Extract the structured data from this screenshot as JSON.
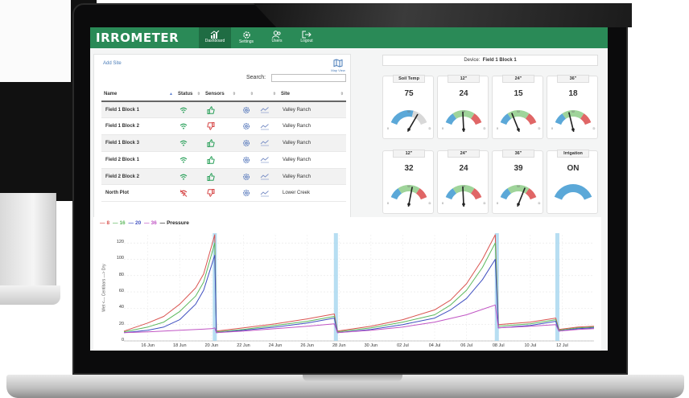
{
  "app": {
    "brand": "IRROMETER",
    "nav": [
      {
        "label": "Dashboard",
        "icon": "chart-bars-icon",
        "active": true
      },
      {
        "label": "Settings",
        "icon": "gear-icon",
        "active": false
      },
      {
        "label": "Users",
        "icon": "users-icon",
        "active": false
      },
      {
        "label": "Logout",
        "icon": "logout-icon",
        "active": false
      }
    ]
  },
  "sites": {
    "add_site": "Add Site",
    "map_view": "Map View",
    "search_label": "Search:",
    "search_value": "",
    "columns": [
      "Name",
      "Status",
      "Sensors",
      "",
      "",
      "Site"
    ],
    "rows": [
      {
        "name": "Field 1 Block 1",
        "status": "online",
        "sensors": "up",
        "site": "Valley Ranch"
      },
      {
        "name": "Field 1 Block 2",
        "status": "online",
        "sensors": "down",
        "site": "Valley Ranch"
      },
      {
        "name": "Field 1 Block 3",
        "status": "online",
        "sensors": "up",
        "site": "Valley Ranch"
      },
      {
        "name": "Field 2 Block 1",
        "status": "online",
        "sensors": "up",
        "site": "Valley Ranch"
      },
      {
        "name": "Field 2 Block 2",
        "status": "online",
        "sensors": "up",
        "site": "Valley Ranch"
      },
      {
        "name": "North Plot",
        "status": "offline",
        "sensors": "down",
        "site": "Lower Creek"
      }
    ]
  },
  "device": {
    "label": "Device:",
    "name": "Field 1 Block 1"
  },
  "gauges": [
    {
      "title": "Soil Temp",
      "value": "75",
      "needle": 0.72,
      "kind": "temp"
    },
    {
      "title": "12\"",
      "value": "24",
      "needle": 0.48,
      "kind": "moisture"
    },
    {
      "title": "24\"",
      "value": "15",
      "needle": 0.34,
      "kind": "moisture"
    },
    {
      "title": "36\"",
      "value": "18",
      "needle": 0.4,
      "kind": "moisture"
    },
    {
      "title": "12\"",
      "value": "32",
      "needle": 0.58,
      "kind": "moisture"
    },
    {
      "title": "24\"",
      "value": "24",
      "needle": 0.48,
      "kind": "moisture"
    },
    {
      "title": "36\"",
      "value": "39",
      "needle": 0.66,
      "kind": "moisture"
    },
    {
      "title": "Irrigation",
      "value": "ON",
      "needle": null,
      "kind": "irrigation"
    }
  ],
  "gauge_scale_labels": {
    "low": "0",
    "mid": "W",
    "high": "D"
  },
  "colors": {
    "brand_green": "#2a8a57",
    "series_8": "#d9534f",
    "series_16": "#5cb85c",
    "series_20": "#3f4fc0",
    "series_36": "#c054c4",
    "pressure": "#222222",
    "gauge_blue": "#5ba8d8",
    "gauge_green": "#9fd49a",
    "gauge_red": "#e06666",
    "irrigation_band": "#9fd3ee"
  },
  "chart_data": {
    "type": "line",
    "legend": [
      "8",
      "16",
      "20",
      "36",
      "Pressure"
    ],
    "ylabel": "Wet <--- Centibars ---> Dry",
    "ylim": [
      0,
      130
    ],
    "yticks": [
      0,
      20,
      40,
      60,
      80,
      100,
      120
    ],
    "x_labels": [
      "16 Jun",
      "18 Jun",
      "20 Jun",
      "22 Jun",
      "24 Jun",
      "26 Jun",
      "28 Jun",
      "30 Jun",
      "02 Jul",
      "04 Jul",
      "06 Jul",
      "08 Jul",
      "10 Jul",
      "12 Jul"
    ],
    "x_days": [
      16,
      18,
      20,
      22,
      24,
      26,
      28,
      30,
      32,
      34,
      36,
      38,
      40,
      42
    ],
    "xlim": [
      14.5,
      44
    ],
    "irrigation_days": [
      20.2,
      27.8,
      37.9,
      41.7
    ],
    "series": [
      {
        "name": "8",
        "x": [
          14.5,
          16,
          17,
          18,
          19,
          19.5,
          20.2,
          20.3,
          22,
          24,
          26,
          27.7,
          27.9,
          30,
          32,
          34,
          35,
          36,
          37,
          37.8,
          38,
          40,
          41.6,
          41.8,
          43,
          44
        ],
        "y": [
          12,
          22,
          30,
          45,
          65,
          82,
          130,
          12,
          16,
          21,
          27,
          33,
          12,
          18,
          26,
          38,
          50,
          70,
          100,
          130,
          20,
          23,
          28,
          14,
          17,
          18
        ]
      },
      {
        "name": "16",
        "x": [
          14.5,
          16,
          17,
          18,
          19,
          19.5,
          20.2,
          20.3,
          22,
          24,
          26,
          27.7,
          27.9,
          30,
          32,
          34,
          35,
          36,
          37,
          37.8,
          38,
          40,
          41.6,
          41.8,
          43,
          44
        ],
        "y": [
          11,
          17,
          23,
          36,
          55,
          72,
          120,
          11,
          14,
          19,
          24,
          30,
          11,
          16,
          23,
          32,
          44,
          62,
          90,
          120,
          18,
          21,
          26,
          13,
          16,
          17
        ]
      },
      {
        "name": "20",
        "x": [
          14.5,
          16,
          17,
          18,
          19,
          19.5,
          20.2,
          20.3,
          22,
          24,
          26,
          27.7,
          27.9,
          30,
          32,
          34,
          35,
          36,
          37,
          37.8,
          38,
          40,
          41.6,
          41.8,
          43,
          44
        ],
        "y": [
          10,
          13,
          17,
          26,
          45,
          62,
          105,
          10,
          13,
          17,
          22,
          28,
          10,
          14,
          20,
          28,
          38,
          52,
          75,
          100,
          16,
          19,
          24,
          12,
          15,
          16
        ]
      },
      {
        "name": "36",
        "x": [
          14.5,
          16,
          18,
          20,
          20.2,
          20.3,
          22,
          24,
          26,
          27.7,
          27.9,
          30,
          32,
          34,
          36,
          37.8,
          38,
          40,
          41.6,
          41.8,
          43,
          44
        ],
        "y": [
          10,
          11,
          13,
          15,
          16,
          10,
          12,
          15,
          18,
          21,
          10,
          13,
          17,
          23,
          32,
          44,
          16,
          18,
          20,
          12,
          14,
          15
        ]
      }
    ]
  }
}
